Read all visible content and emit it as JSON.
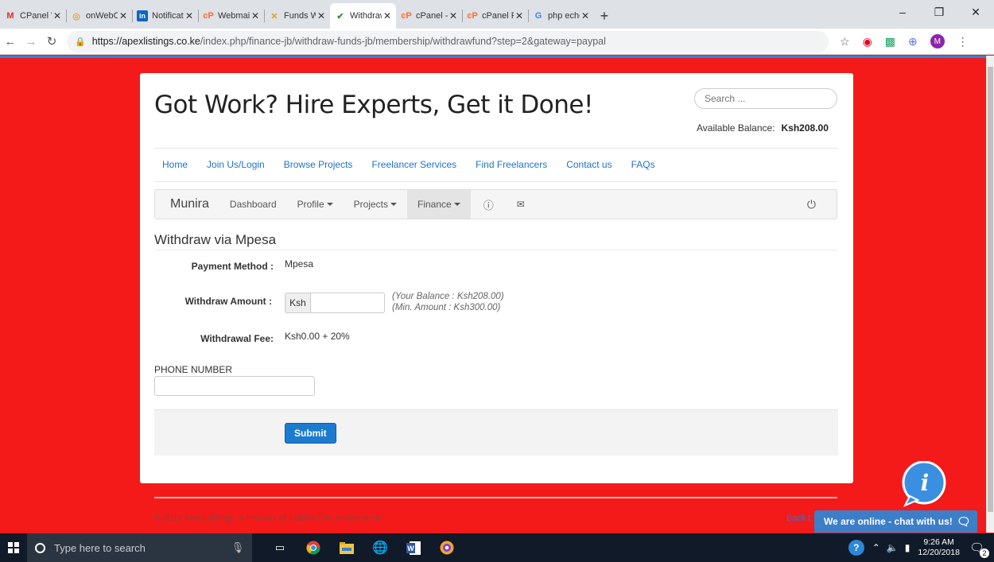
{
  "browser": {
    "tabs": [
      {
        "title": "CPanel Wel",
        "icon": "gmail-icon",
        "active": false
      },
      {
        "title": "onWebChat",
        "icon": "onwebchat-icon",
        "active": false
      },
      {
        "title": "Notification",
        "icon": "linkedin-icon",
        "active": false
      },
      {
        "title": "Webmail - ",
        "icon": "cpanel-icon",
        "active": false
      },
      {
        "title": "Funds With",
        "icon": "funds-icon",
        "active": false
      },
      {
        "title": "Withdraw F",
        "icon": "withdraw-icon",
        "active": true
      },
      {
        "title": "cPanel - Ma",
        "icon": "cpanel-icon",
        "active": false
      },
      {
        "title": "cPanel File ",
        "icon": "cpanel-icon",
        "active": false
      },
      {
        "title": "php echo fo",
        "icon": "google-icon",
        "active": false
      }
    ],
    "url_host": "https://apexlistings.co.ke",
    "url_path": "/index.php/finance-jb/withdraw-funds-jb/membership/withdrawfund?step=2&gateway=paypal",
    "profile_initial": "M"
  },
  "site": {
    "headline": "Got Work? Hire Experts, Get it Done!",
    "search_placeholder": "Search ...",
    "balance_label": "Available Balance:",
    "balance_value": "Ksh208.00",
    "nav": [
      "Home",
      "Join Us/Login",
      "Browse Projects",
      "Freelancer Services",
      "Find Freelancers",
      "Contact us",
      "FAQs"
    ]
  },
  "userbar": {
    "name": "Munira",
    "dashboard": "Dashboard",
    "profile": "Profile",
    "projects": "Projects",
    "finance": "Finance"
  },
  "form": {
    "title": "Withdraw via Mpesa",
    "payment_method_label": "Payment Method :",
    "payment_method_value": "Mpesa",
    "withdraw_amount_label": "Withdraw Amount :",
    "currency_addon": "Ksh",
    "hint_balance": "(Your Balance : Ksh208.00)",
    "hint_min": "(Min. Amount : Ksh300.00)",
    "fee_label": "Withdrawal Fee:",
    "fee_value": "Ksh0.00 + 20%",
    "phone_label": "PHONE NUMBER",
    "submit_label": "Submit"
  },
  "footer": {
    "copyright": "© 2018 ApexListings, A Product of Kaicha Fari Investments",
    "back_to_top": "Back t"
  },
  "chat": {
    "label": "We are online - chat with us!"
  },
  "taskbar": {
    "search_placeholder": "Type here to search",
    "time": "9:26 AM",
    "date": "12/20/2018",
    "notification_count": "2"
  },
  "colors": {
    "page_background": "#f41a1a",
    "link": "#1f73c6",
    "submit": "#1b7bd1",
    "chat": "#3d7ec8"
  }
}
